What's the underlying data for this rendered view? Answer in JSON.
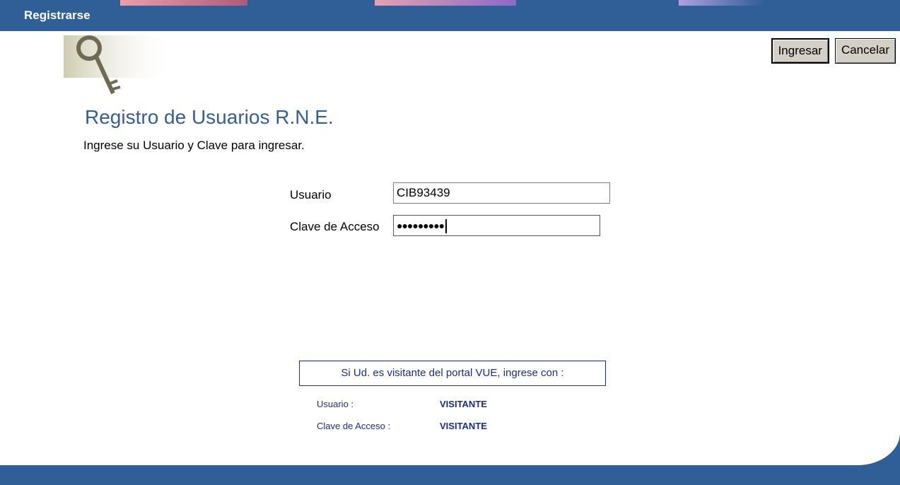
{
  "window": {
    "title": "Registrarse"
  },
  "toolbar": {
    "ingresar_label": "Ingresar",
    "cancelar_label": "Cancelar"
  },
  "form": {
    "heading": "Registro de Usuarios R.N.E.",
    "subheading": "Ingrese su Usuario y Clave para ingresar.",
    "usuario_label": "Usuario",
    "usuario_value": "CIB93439",
    "clave_label": "Clave de Acceso",
    "clave_value": "●●●●●●●●●"
  },
  "visitor": {
    "title": "Si Ud. es visitante del portal VUE, ingrese con :",
    "usuario_label": "Usuario :",
    "usuario_value": "VISITANTE",
    "clave_label": "Clave de Acceso :",
    "clave_value": "VISITANTE"
  },
  "colors": {
    "header_blue": "#2f5f96",
    "heading_blue": "#355e98",
    "visitor_blue": "#1c2d86"
  }
}
